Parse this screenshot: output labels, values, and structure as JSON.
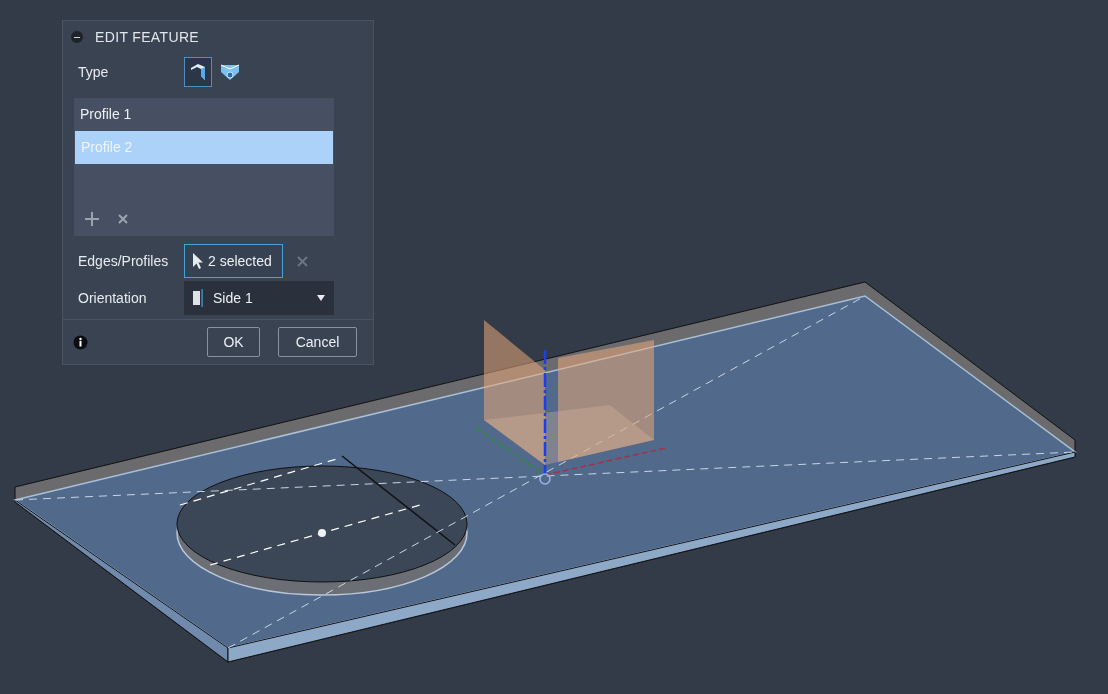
{
  "dialog": {
    "title": "EDIT FEATURE",
    "type": {
      "label": "Type",
      "options": [
        {
          "kind": "corner",
          "selected": true
        },
        {
          "kind": "shell",
          "selected": false
        }
      ]
    },
    "profiles": [
      {
        "label": "Profile 1",
        "selected": false
      },
      {
        "label": "Profile 2",
        "selected": true
      }
    ],
    "edges": {
      "label": "Edges/Profiles",
      "value": "2 selected"
    },
    "orientation": {
      "label": "Orientation",
      "value": "Side 1"
    },
    "buttons": [
      "OK",
      "Cancel"
    ]
  }
}
